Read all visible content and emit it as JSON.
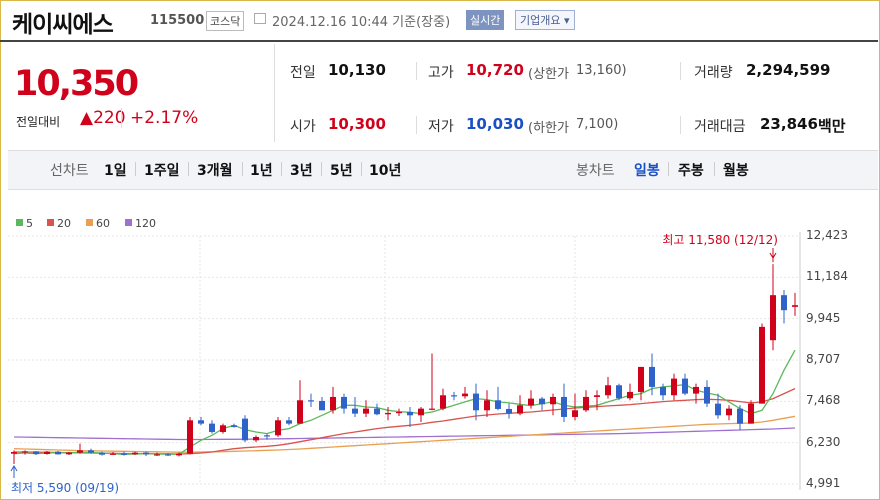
{
  "header": {
    "stock_name": "케이씨에스",
    "stock_code": "115500",
    "market": "코스닥",
    "timestamp": "2024.12.16 10:44 기준(장중)",
    "realtime_button": "실시간",
    "company_info_button": "기업개요",
    "company_info_arrow": "▾"
  },
  "price": {
    "current": "10,350",
    "change_label": "전일대비",
    "change_arrow": "▲",
    "change_value": "220",
    "change_percent": "+2.17%"
  },
  "quote": {
    "prev_close": {
      "label": "전일",
      "value": "10,130"
    },
    "high": {
      "label": "고가",
      "value": "10,720",
      "limit_label": "(상한가",
      "limit_value": "13,160)"
    },
    "volume": {
      "label": "거래량",
      "value": "2,294,599"
    },
    "open": {
      "label": "시가",
      "value": "10,300"
    },
    "low": {
      "label": "저가",
      "value": "10,030",
      "limit_label": "(하한가",
      "limit_value": "7,100)"
    },
    "amount": {
      "label": "거래대금",
      "value": "23,846",
      "unit": "백만"
    }
  },
  "period_bar": {
    "line_chart_label": "선차트",
    "line_periods": [
      "1일",
      "1주일",
      "3개월",
      "1년",
      "3년",
      "5년",
      "10년"
    ],
    "candle_chart_label": "봉차트",
    "candle_periods": [
      "일봉",
      "주봉",
      "월봉"
    ],
    "active_candle_period": "일봉"
  },
  "chart_data": {
    "type": "candlestick",
    "legend": [
      {
        "name": "5",
        "color": "#5cb85c"
      },
      {
        "name": "20",
        "color": "#d9534f"
      },
      {
        "name": "60",
        "color": "#e8a050"
      },
      {
        "name": "120",
        "color": "#a070d0"
      }
    ],
    "y_ticks": [
      "12,423",
      "11,184",
      "9,945",
      "8,707",
      "7,468",
      "6,230",
      "4,991"
    ],
    "ylim": [
      4991,
      12423
    ],
    "high_annotation": "최고 11,580 (12/12)",
    "low_annotation": "최저 5,590 (09/19)",
    "up_color": "#d0021b",
    "down_color": "#2f63c9",
    "candles": [
      [
        5900,
        6000,
        5590,
        5950
      ],
      [
        5950,
        6000,
        5870,
        5970
      ],
      [
        5970,
        5980,
        5860,
        5890
      ],
      [
        5890,
        5980,
        5870,
        5960
      ],
      [
        5960,
        5980,
        5870,
        5880
      ],
      [
        5880,
        5950,
        5860,
        5930
      ],
      [
        5930,
        6200,
        5900,
        6000
      ],
      [
        6000,
        6050,
        5900,
        5930
      ],
      [
        5930,
        5960,
        5840,
        5870
      ],
      [
        5870,
        5950,
        5860,
        5900
      ],
      [
        5900,
        5960,
        5840,
        5880
      ],
      [
        5880,
        5960,
        5860,
        5930
      ],
      [
        5930,
        5960,
        5830,
        5880
      ],
      [
        5880,
        5930,
        5830,
        5880
      ],
      [
        5880,
        5920,
        5830,
        5850
      ],
      [
        5850,
        5930,
        5820,
        5900
      ],
      [
        5900,
        7000,
        5880,
        6900
      ],
      [
        6900,
        7000,
        6750,
        6800
      ],
      [
        6800,
        6900,
        6500,
        6550
      ],
      [
        6550,
        6800,
        6500,
        6750
      ],
      [
        6750,
        6800,
        6680,
        6700
      ],
      [
        6950,
        7050,
        6250,
        6300
      ],
      [
        6300,
        6450,
        6250,
        6400
      ],
      [
        6450,
        6500,
        6320,
        6420
      ],
      [
        6450,
        7000,
        6400,
        6900
      ],
      [
        6900,
        7000,
        6750,
        6800
      ],
      [
        6800,
        8100,
        6800,
        7500
      ],
      [
        7500,
        7700,
        7300,
        7480
      ],
      [
        7480,
        7600,
        7200,
        7200
      ],
      [
        7200,
        7900,
        7100,
        7600
      ],
      [
        7600,
        7700,
        7100,
        7250
      ],
      [
        7250,
        7600,
        7000,
        7100
      ],
      [
        7100,
        7500,
        7000,
        7250
      ],
      [
        7250,
        7400,
        7050,
        7080
      ],
      [
        7080,
        7300,
        6900,
        7120
      ],
      [
        7120,
        7250,
        7030,
        7150
      ],
      [
        7150,
        7300,
        6700,
        7050
      ],
      [
        7050,
        7300,
        6850,
        7250
      ],
      [
        7250,
        8900,
        7200,
        7250
      ],
      [
        7250,
        7850,
        7200,
        7650
      ],
      [
        7650,
        7750,
        7500,
        7620
      ],
      [
        7620,
        7900,
        7550,
        7700
      ],
      [
        7700,
        8000,
        6900,
        7200
      ],
      [
        7200,
        7800,
        7000,
        7500
      ],
      [
        7500,
        7900,
        7200,
        7240
      ],
      [
        7240,
        7400,
        6950,
        7100
      ],
      [
        7100,
        7650,
        7050,
        7350
      ],
      [
        7350,
        7800,
        7250,
        7550
      ],
      [
        7550,
        7600,
        7200,
        7380
      ],
      [
        7380,
        7700,
        7050,
        7600
      ],
      [
        7600,
        8000,
        6850,
        7000
      ],
      [
        7000,
        7700,
        6900,
        7200
      ],
      [
        7200,
        7800,
        7150,
        7600
      ],
      [
        7600,
        7800,
        7200,
        7650
      ],
      [
        7650,
        8200,
        7550,
        7950
      ],
      [
        7950,
        8000,
        7500,
        7560
      ],
      [
        7560,
        8000,
        7500,
        7750
      ],
      [
        7750,
        8500,
        7500,
        8500
      ],
      [
        8500,
        8900,
        7650,
        7900
      ],
      [
        7900,
        8000,
        7500,
        7650
      ],
      [
        7650,
        8300,
        7500,
        8150
      ],
      [
        8150,
        8300,
        7650,
        7700
      ],
      [
        7700,
        8000,
        7400,
        7900
      ],
      [
        7900,
        8100,
        7300,
        7400
      ],
      [
        7400,
        7700,
        6950,
        7050
      ],
      [
        7050,
        7350,
        6900,
        7250
      ],
      [
        7250,
        7350,
        6600,
        6800
      ],
      [
        6800,
        7500,
        6800,
        7400
      ],
      [
        7400,
        9800,
        7400,
        9700
      ],
      [
        9300,
        11580,
        9000,
        10650
      ],
      [
        10650,
        10800,
        9800,
        10200
      ],
      [
        10300,
        10720,
        10030,
        10350
      ]
    ],
    "ma5": [
      5900,
      5920,
      5900,
      5920,
      5930,
      5920,
      5940,
      5935,
      5920,
      5900,
      5880,
      5890,
      5900,
      5890,
      5885,
      5885,
      6100,
      6300,
      6450,
      6650,
      6750,
      6620,
      6550,
      6500,
      6600,
      6650,
      6800,
      6900,
      7050,
      7200,
      7350,
      7350,
      7300,
      7280,
      7200,
      7160,
      7140,
      7100,
      7150,
      7250,
      7350,
      7450,
      7550,
      7520,
      7450,
      7420,
      7380,
      7340,
      7400,
      7450,
      7350,
      7300,
      7320,
      7350,
      7450,
      7550,
      7650,
      7700,
      7850,
      7900,
      7930,
      7970,
      7800,
      7720,
      7650,
      7450,
      7250,
      7100,
      7200,
      7700,
      8400,
      9000
    ],
    "ma20": [
      5950,
      5950,
      5945,
      5940,
      5935,
      5930,
      5925,
      5920,
      5915,
      5910,
      5905,
      5900,
      5900,
      5895,
      5895,
      5890,
      5900,
      5920,
      5950,
      6000,
      6050,
      6080,
      6100,
      6120,
      6150,
      6200,
      6260,
      6320,
      6380,
      6440,
      6500,
      6550,
      6600,
      6650,
      6690,
      6720,
      6750,
      6790,
      6840,
      6880,
      6930,
      6980,
      7030,
      7060,
      7090,
      7110,
      7130,
      7150,
      7180,
      7210,
      7240,
      7270,
      7290,
      7310,
      7330,
      7350,
      7370,
      7400,
      7430,
      7460,
      7480,
      7500,
      7520,
      7530,
      7520,
      7500,
      7460,
      7420,
      7450,
      7550,
      7700,
      7850
    ],
    "ma60": [
      6050,
      6040,
      6030,
      6020,
      6010,
      6000,
      5990,
      5985,
      5980,
      5975,
      5970,
      5965,
      5960,
      5955,
      5950,
      5945,
      5945,
      5950,
      5955,
      5960,
      5970,
      5980,
      5990,
      6000,
      6010,
      6025,
      6040,
      6060,
      6080,
      6100,
      6120,
      6140,
      6160,
      6180,
      6200,
      6220,
      6240,
      6260,
      6280,
      6300,
      6320,
      6340,
      6360,
      6380,
      6400,
      6420,
      6440,
      6460,
      6480,
      6500,
      6520,
      6540,
      6560,
      6580,
      6600,
      6620,
      6640,
      6660,
      6680,
      6700,
      6720,
      6740,
      6760,
      6780,
      6790,
      6800,
      6810,
      6820,
      6850,
      6900,
      6960,
      7020
    ],
    "ma120": [
      6400,
      6395,
      6390,
      6385,
      6380,
      6375,
      6370,
      6365,
      6360,
      6355,
      6350,
      6345,
      6340,
      6335,
      6330,
      6325,
      6325,
      6325,
      6328,
      6330,
      6332,
      6335,
      6338,
      6340,
      6345,
      6350,
      6355,
      6360,
      6365,
      6370,
      6375,
      6380,
      6385,
      6390,
      6395,
      6400,
      6405,
      6410,
      6415,
      6420,
      6425,
      6430,
      6435,
      6440,
      6445,
      6450,
      6455,
      6460,
      6465,
      6470,
      6475,
      6480,
      6485,
      6490,
      6495,
      6500,
      6510,
      6520,
      6530,
      6540,
      6550,
      6560,
      6570,
      6580,
      6590,
      6600,
      6610,
      6620,
      6630,
      6640,
      6655,
      6670
    ]
  }
}
